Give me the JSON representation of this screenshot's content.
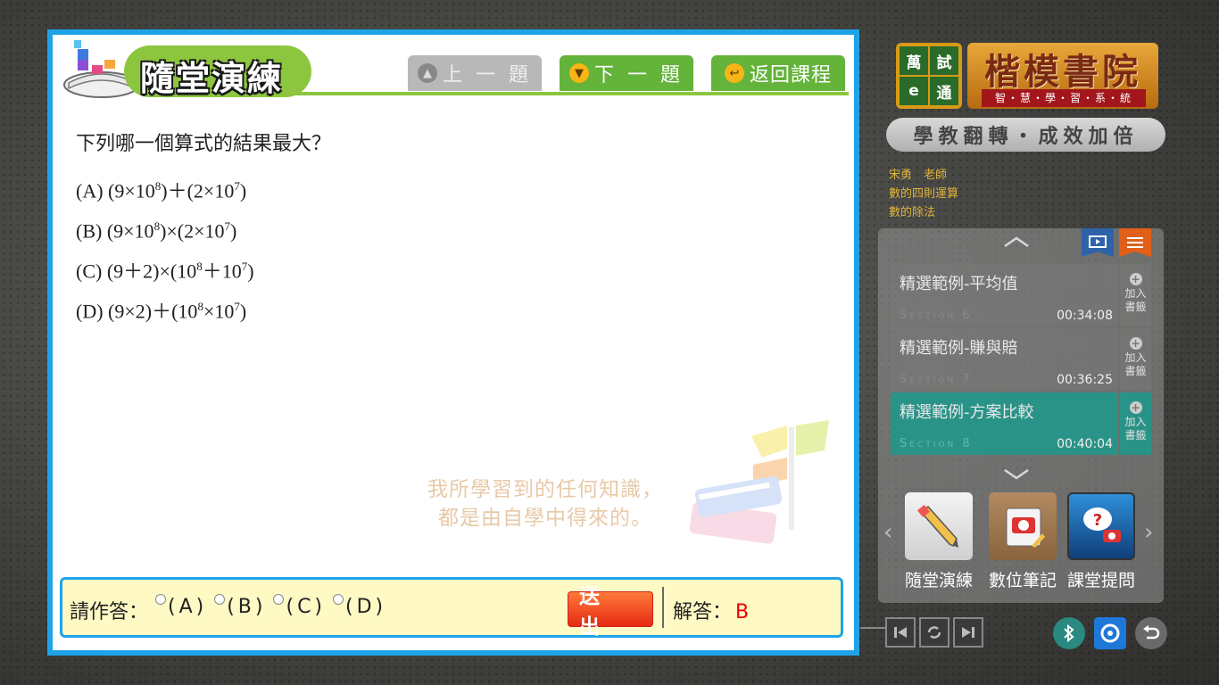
{
  "header": {
    "title": "隨堂演練",
    "prev_label": "上 一 題",
    "next_label": "下 一 題",
    "back_label": "返回課程"
  },
  "question": {
    "text": "下列哪一個算式的結果最大？",
    "options": [
      {
        "pre": "(A) (9×10",
        "sup1": "8",
        "mid": ")＋(2×10",
        "sup2": "7",
        "post": ")"
      },
      {
        "pre": "(B) (9×10",
        "sup1": "8",
        "mid": ")×(2×10",
        "sup2": "7",
        "post": ")"
      },
      {
        "pre": "(C) (9＋2)×(10",
        "sup1": "8",
        "mid": "＋10",
        "sup2": "7",
        "post": ")"
      },
      {
        "pre": "(D) (9×2)＋(10",
        "sup1": "8",
        "mid": "×10",
        "sup2": "7",
        "post": ")"
      }
    ]
  },
  "watermark": {
    "line1": "我所學習到的任何知識，",
    "line2": "都是由自學中得來的。"
  },
  "answer": {
    "prompt": "請作答：",
    "choices": [
      "(A)",
      "(B)",
      "(C)",
      "(D)"
    ],
    "submit_label": "送 出",
    "result_label": "解答：",
    "result_value": "B"
  },
  "brand": {
    "cells": [
      "萬",
      "試",
      "e",
      "通"
    ],
    "name": "楷模書院",
    "subtitle": "智・慧・學・習・系・統",
    "slogan": "學教翻轉・成效加倍"
  },
  "course_info": {
    "teacher": "宋勇　老師",
    "course": "數的四則運算",
    "lesson": "數的除法"
  },
  "sections": [
    {
      "title": "精選範例-平均值",
      "code": "Section 6",
      "time": "00:34:08",
      "active": false
    },
    {
      "title": "精選範例-賺與賠",
      "code": "Section 7",
      "time": "00:36:25",
      "active": false
    },
    {
      "title": "精選範例-方案比較",
      "code": "Section 8",
      "time": "00:40:04",
      "active": true
    }
  ],
  "bookmark_label_1": "加入",
  "bookmark_label_2": "書籤",
  "tools": [
    {
      "label": "隨堂演練",
      "icon": "pencil-icon"
    },
    {
      "label": "數位筆記",
      "icon": "notebook-icon"
    },
    {
      "label": "課堂提問",
      "icon": "question-icon"
    }
  ],
  "colors": {
    "panel_border": "#1fa3e8",
    "header_green": "#64b33a",
    "active_section": "#2a9388",
    "answer_red": "#e00000"
  }
}
